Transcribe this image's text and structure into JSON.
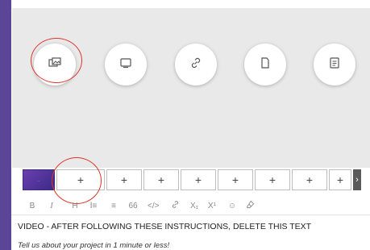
{
  "media_buttons": [
    {
      "icon": "image-gallery-icon"
    },
    {
      "icon": "monitor-icon"
    },
    {
      "icon": "link-icon"
    },
    {
      "icon": "document-icon"
    },
    {
      "icon": "text-file-icon"
    }
  ],
  "thumbs": {
    "first_label": "...",
    "add_label": "+",
    "count": 9
  },
  "scroll_arrow": "›",
  "toolbar": {
    "bold": "B",
    "italic": "I",
    "heading": "H",
    "ordered_list": "Ⅰ≡",
    "bullet_list": "≡",
    "quote": "66",
    "code": "</>",
    "link": "ℒ",
    "subscript": "X₁",
    "superscript": "X¹",
    "emoji": "☺",
    "clear_format": "⌀"
  },
  "editor": {
    "line1": "VIDEO - AFTER FOLLOWING THESE INSTRUCTIONS, DELETE THIS TEXT",
    "line2": "Tell us about your project in 1 minute or less!"
  },
  "colors": {
    "frame": "#5a4596",
    "highlight_ring": "#e0352b"
  }
}
